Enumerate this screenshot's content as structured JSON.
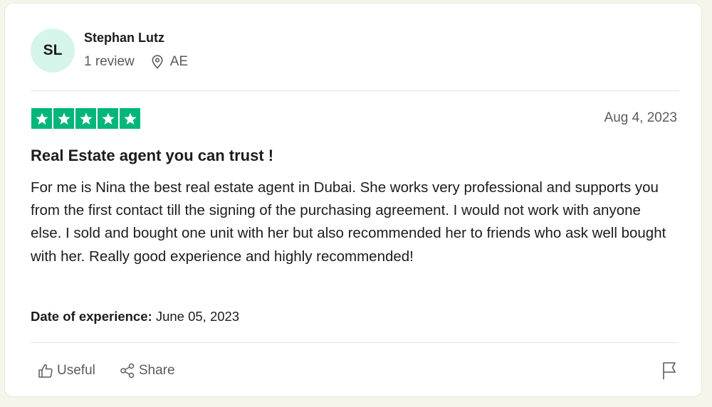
{
  "reviewer": {
    "initials": "SL",
    "name": "Stephan Lutz",
    "review_count": "1 review",
    "country": "AE"
  },
  "review": {
    "rating": 5,
    "date": "Aug 4, 2023",
    "title": "Real Estate agent you can trust !",
    "body": "For me is Nina the best real estate agent in Dubai. She works very professional and supports you from the first contact till the signing of the purchasing agreement. I would not work with anyone else. I sold and bought one unit with her but also recommended her to friends who ask well bought with her. Really good experience and highly recommended!",
    "experience_label": "Date of experience:",
    "experience_date": "June 05, 2023"
  },
  "actions": {
    "useful_label": "Useful",
    "share_label": "Share"
  },
  "icons": {
    "location": "location-pin-icon",
    "star": "star-icon",
    "useful": "thumbs-up-icon",
    "share": "share-icon",
    "report": "flag-icon"
  },
  "colors": {
    "star_green": "#00b67a",
    "avatar_bg": "#d6f5ea",
    "page_bg": "#f6f5ec"
  }
}
